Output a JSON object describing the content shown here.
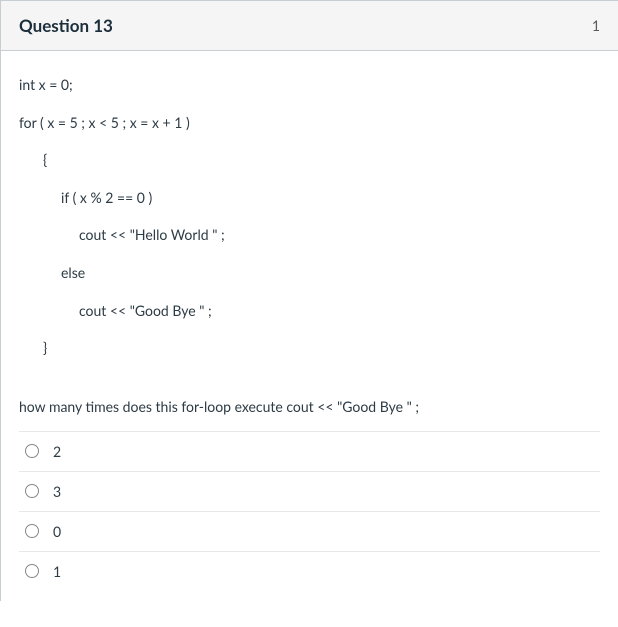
{
  "header": {
    "title": "Question 13",
    "points": "1"
  },
  "code": {
    "l1": "int x = 0;",
    "l2": "for ( x = 5 ; x < 5 ; x = x + 1 )",
    "l3": "{",
    "l4": "if ( x % 2 == 0 )",
    "l5": "cout << \"Hello World \" ;",
    "l6": "else",
    "l7": "cout << \"Good Bye \" ;",
    "l8": "}"
  },
  "question": "how many times does this for-loop execute  cout << \"Good Bye \" ;",
  "options": [
    {
      "label": "2"
    },
    {
      "label": "3"
    },
    {
      "label": "0"
    },
    {
      "label": "1"
    }
  ]
}
